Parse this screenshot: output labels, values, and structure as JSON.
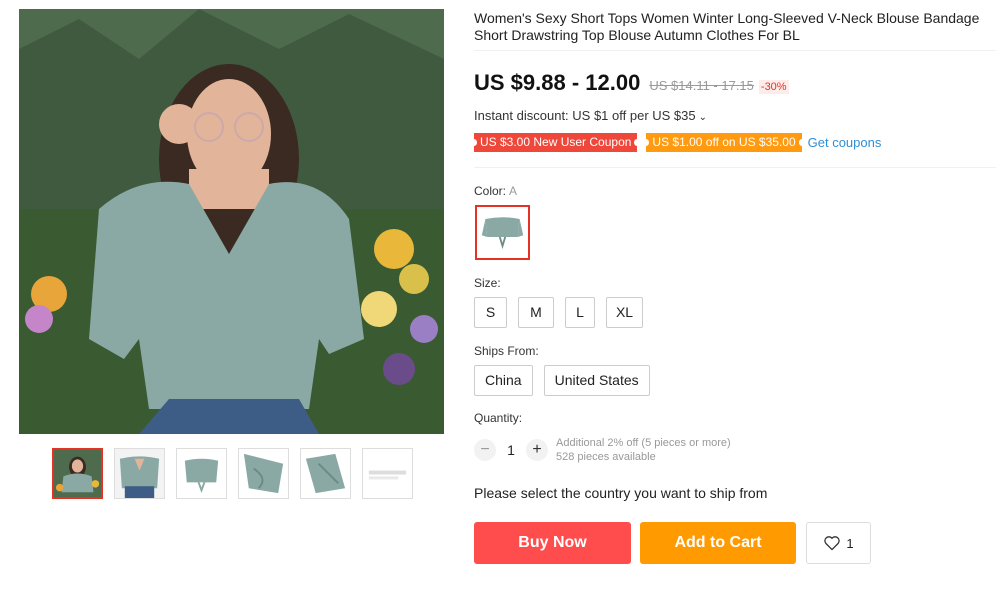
{
  "product": {
    "title": "Women's Sexy Short Tops Women Winter Long-Sleeved V-Neck Blouse Bandage Short Drawstring Top Blouse Autumn Clothes For BL"
  },
  "price": {
    "current": "US $9.88 - 12.00",
    "original": "US $14.11 - 17.15",
    "discount": "-30%"
  },
  "promo": {
    "instant_discount": "Instant discount: US $1 off per US $35",
    "coupons": [
      "US $3.00 New User Coupon",
      "US $1.00 off on US $35.00"
    ],
    "get_coupons": "Get coupons"
  },
  "color": {
    "label": "Color:",
    "selected": "A"
  },
  "size": {
    "label": "Size:",
    "options": [
      "S",
      "M",
      "L",
      "XL"
    ]
  },
  "ships_from": {
    "label": "Ships From:",
    "options": [
      "China",
      "United States"
    ]
  },
  "quantity": {
    "label": "Quantity:",
    "minus": "−",
    "value": "1",
    "plus": "+",
    "discount_note": "Additional 2% off (5 pieces or more)",
    "available": "528 pieces available"
  },
  "ship_message": "Please select the country you want to ship from",
  "actions": {
    "buy_now": "Buy Now",
    "add_to_cart": "Add to Cart",
    "wishlist_count": "1"
  },
  "colors": {
    "accent_red": "#e43225",
    "buy": "#ff4d4d",
    "cart": "#ff9a00",
    "link": "#2f8fd6"
  },
  "icons": {
    "wishlist": "heart-icon",
    "dropdown": "chevron-down-icon"
  }
}
